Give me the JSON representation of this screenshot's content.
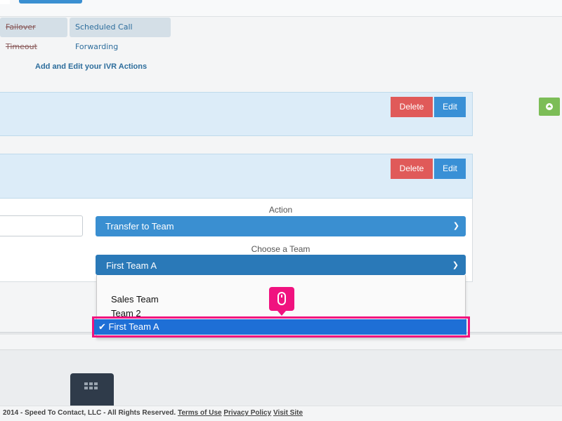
{
  "tabs": [
    {
      "label": "Failover Timeout",
      "strikethrough": true
    },
    {
      "label": "Scheduled Call Forwarding"
    }
  ],
  "heading": "Add and Edit your IVR Actions",
  "panels": [
    {
      "delete_label": "Delete",
      "edit_label": "Edit"
    },
    {
      "delete_label": "Delete",
      "edit_label": "Edit"
    }
  ],
  "form": {
    "action_label": "Action",
    "action_value": "Transfer to Team",
    "team_label": "Choose a Team",
    "team_value": "First Team A"
  },
  "dropdown": {
    "options": [
      "Sales Team",
      "Team 2",
      "First Team A"
    ],
    "selected_label": "✔ First Team A"
  },
  "footer": {
    "copyright": "2014 - Speed To Contact, LLC - All Rights Reserved.",
    "terms": "Terms of Use",
    "privacy": "Privacy Policy",
    "visit": "Visit Site"
  },
  "colors": {
    "delete": "#e05a59",
    "edit": "#3990d6",
    "highlight": "#f0127f",
    "selected_option": "#1e6fd6",
    "add_button": "#7cbd57"
  },
  "icons": {
    "chevron": "chevron-down-icon",
    "mouse": "mouse-icon",
    "grid": "grid-icon",
    "add": "arrow-up-circle-icon"
  }
}
